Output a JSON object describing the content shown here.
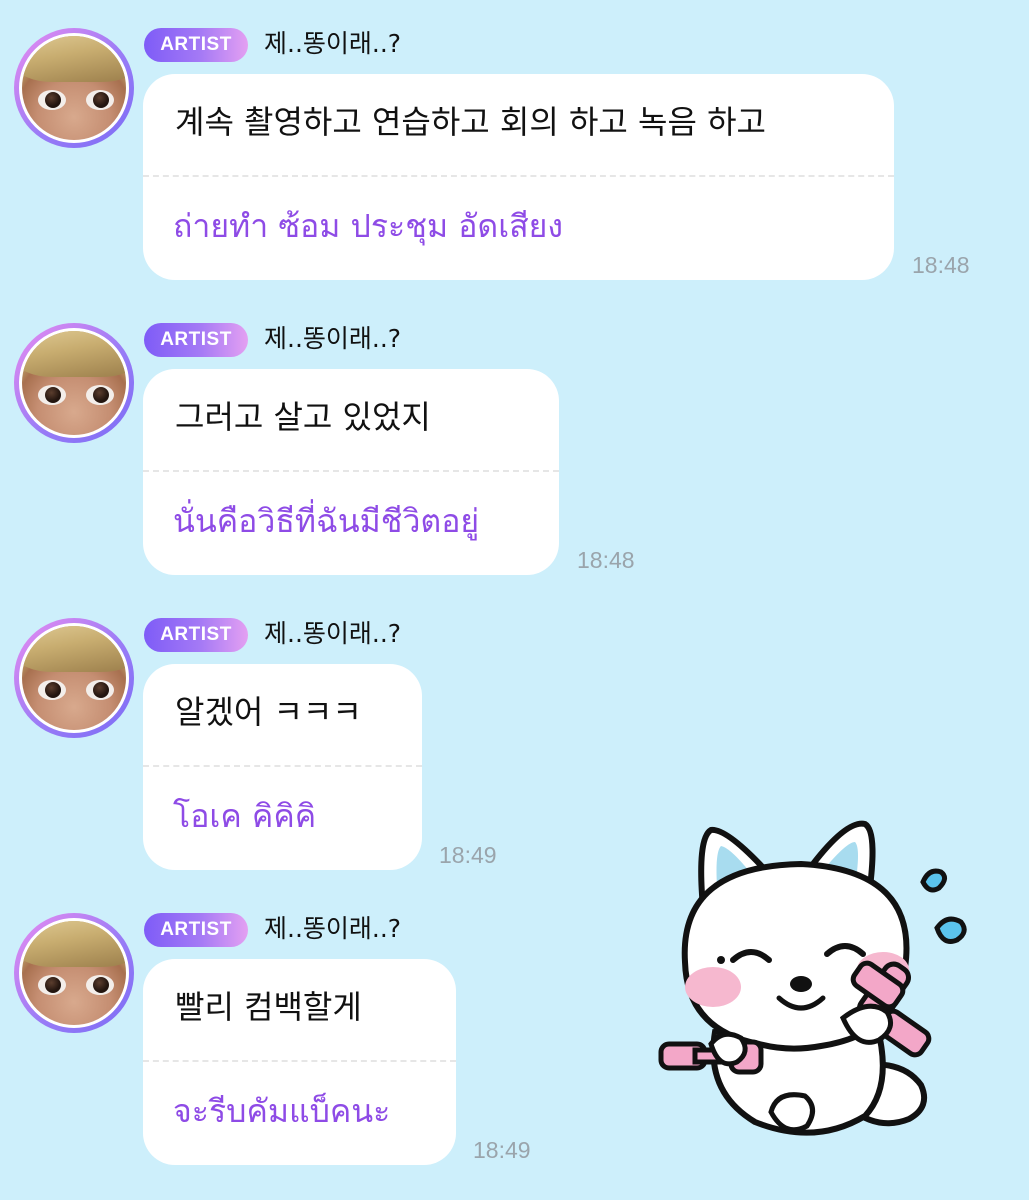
{
  "chat": {
    "messages": [
      {
        "badge": "ARTIST",
        "sender": "제..똥이래..?",
        "text_ko": "계속 촬영하고 연습하고 회의 하고 녹음 하고",
        "text_th": "ถ่ายทำ ซ้อม ประชุม อัดเสียง",
        "time": "18:48"
      },
      {
        "badge": "ARTIST",
        "sender": "제..똥이래..?",
        "text_ko": "그러고 살고 있었지",
        "text_th": "นั่นคือวิธีที่ฉันมีชีวิตอยู่",
        "time": "18:48"
      },
      {
        "badge": "ARTIST",
        "sender": "제..똥이래..?",
        "text_ko": "알겠어 ㅋㅋㅋ",
        "text_th": "โอเค คิคิคิ",
        "time": "18:49"
      },
      {
        "badge": "ARTIST",
        "sender": "제..똥이래..?",
        "text_ko": "빨리 컴백할게",
        "text_th": "จะรีบคัมแบ็คนะ",
        "time": "18:49"
      }
    ],
    "sticker": {
      "icon": "white-fox-dumbbell-sticker"
    }
  },
  "colors": {
    "background": "#cdeffb",
    "badge_start": "#7e5cf7",
    "badge_end": "#e4a0f2",
    "translation_text": "#8e4be6",
    "time_text": "#9aa4ab"
  }
}
